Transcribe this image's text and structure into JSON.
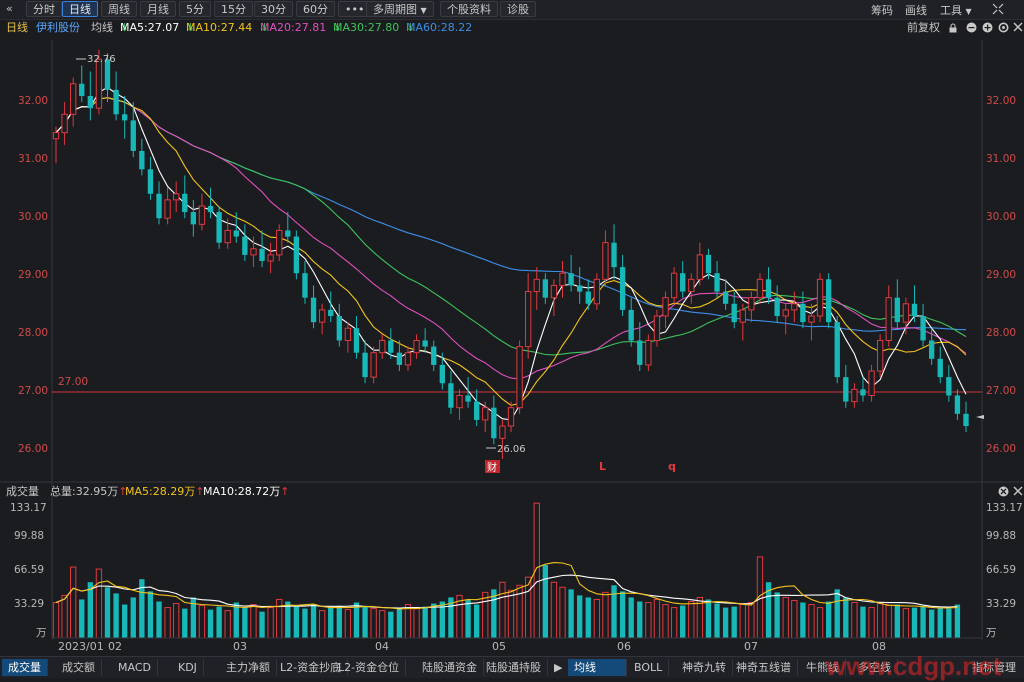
{
  "toolbar": {
    "back": "«",
    "tabs": [
      "分时",
      "日线",
      "周线",
      "月线",
      "5分",
      "15分",
      "30分",
      "60分"
    ],
    "more": "•••",
    "multi_period": "多周期图",
    "multi_arrow": "▼",
    "stock_info": "个股资料",
    "diagnose": "诊股",
    "chips": "筹码",
    "draw": "画线",
    "tools": "工具",
    "tools_arrow": "▼"
  },
  "ma_legend": {
    "period": "日线",
    "stock_name": "伊利股份",
    "avg_line": "均线",
    "ma5": "MA5:27.07",
    "ma10": "MA10:27.44",
    "ma20": "MA20:27.81",
    "ma30": "MA30:27.80",
    "ma60": "MA60:28.22",
    "down_arrow": "↓",
    "adjust": "前复权"
  },
  "price_axis": [
    "32.00",
    "31.00",
    "30.00",
    "29.00",
    "28.00",
    "27.00",
    "26.00"
  ],
  "annotations": {
    "high": "32.76",
    "low": "26.06",
    "ref_line": "27.00",
    "marker_cai": "财",
    "marker_L": "L",
    "marker_q": "q"
  },
  "volume_legend": {
    "title": "成交量",
    "total": "总量:32.95万",
    "ma5": "MA5:28.29万",
    "ma10": "MA10:28.72万",
    "up_arrow": "↑"
  },
  "volume_axis": [
    "133.17",
    "99.88",
    "66.59",
    "33.29",
    "万"
  ],
  "x_axis": [
    "2023/01",
    "02",
    "03",
    "04",
    "05",
    "06",
    "07",
    "08"
  ],
  "bottom_tabs_left": [
    "成交量",
    "成交额",
    "MACD",
    "KDJ",
    "主力净额",
    "L2-资金抄底",
    "L2-资金仓位",
    "陆股通资金",
    "陆股通持股"
  ],
  "bottom_tabs_right": [
    "均线",
    "BOLL",
    "神奇九转",
    "神奇五线谱",
    "牛熊线",
    "多空线",
    "指标管理"
  ],
  "scroll_arrow": "▶",
  "watermark": "www.cdgp.net",
  "colors": {
    "up": "#e0393e",
    "down": "#19b8b8",
    "ma5": "#ffffff",
    "ma10": "#f2c31b",
    "ma20": "#e04fbf",
    "ma30": "#3cc35a",
    "ma60": "#3d8ee8",
    "axis": "#d04a4a",
    "accent": "#3b7fd9"
  },
  "chart_data": {
    "type": "candlestick",
    "ylim": [
      25.75,
      32.85
    ],
    "volume_ylim": [
      0,
      133.17
    ],
    "ohlc": [
      [
        31.3,
        31.5,
        30.9,
        31.4
      ],
      [
        31.4,
        31.9,
        31.2,
        31.7
      ],
      [
        31.7,
        32.3,
        31.5,
        32.2
      ],
      [
        32.2,
        32.5,
        31.9,
        32.0
      ],
      [
        32.0,
        32.4,
        31.6,
        31.8
      ],
      [
        31.8,
        32.76,
        31.7,
        32.6
      ],
      [
        32.6,
        32.7,
        31.9,
        32.1
      ],
      [
        32.1,
        32.4,
        31.6,
        31.7
      ],
      [
        31.7,
        32.0,
        31.3,
        31.6
      ],
      [
        31.6,
        31.9,
        31.0,
        31.1
      ],
      [
        31.1,
        31.3,
        30.7,
        30.8
      ],
      [
        30.8,
        31.0,
        30.3,
        30.4
      ],
      [
        30.4,
        30.6,
        29.9,
        30.0
      ],
      [
        30.0,
        30.5,
        29.9,
        30.3
      ],
      [
        30.3,
        30.6,
        30.1,
        30.4
      ],
      [
        30.4,
        30.7,
        30.0,
        30.1
      ],
      [
        30.1,
        30.3,
        29.7,
        29.9
      ],
      [
        29.9,
        30.4,
        29.8,
        30.2
      ],
      [
        30.2,
        30.5,
        30.0,
        30.1
      ],
      [
        30.1,
        30.2,
        29.5,
        29.6
      ],
      [
        29.6,
        30.0,
        29.5,
        29.8
      ],
      [
        29.8,
        30.1,
        29.6,
        29.7
      ],
      [
        29.7,
        29.9,
        29.3,
        29.4
      ],
      [
        29.4,
        29.7,
        29.2,
        29.5
      ],
      [
        29.5,
        29.8,
        29.2,
        29.3
      ],
      [
        29.3,
        29.6,
        29.1,
        29.4
      ],
      [
        29.4,
        29.9,
        29.3,
        29.8
      ],
      [
        29.8,
        30.1,
        29.6,
        29.7
      ],
      [
        29.7,
        29.8,
        29.0,
        29.1
      ],
      [
        29.1,
        29.3,
        28.6,
        28.7
      ],
      [
        28.7,
        28.9,
        28.2,
        28.3
      ],
      [
        28.3,
        28.6,
        28.1,
        28.5
      ],
      [
        28.5,
        28.8,
        28.3,
        28.4
      ],
      [
        28.4,
        28.6,
        27.9,
        28.0
      ],
      [
        28.0,
        28.3,
        27.8,
        28.2
      ],
      [
        28.2,
        28.4,
        27.7,
        27.8
      ],
      [
        27.8,
        28.0,
        27.3,
        27.4
      ],
      [
        27.4,
        27.9,
        27.3,
        27.8
      ],
      [
        27.8,
        28.1,
        27.7,
        28.0
      ],
      [
        28.0,
        28.2,
        27.7,
        27.8
      ],
      [
        27.8,
        28.0,
        27.5,
        27.6
      ],
      [
        27.6,
        27.9,
        27.5,
        27.8
      ],
      [
        27.8,
        28.1,
        27.7,
        28.0
      ],
      [
        28.0,
        28.2,
        27.8,
        27.9
      ],
      [
        27.9,
        28.0,
        27.5,
        27.6
      ],
      [
        27.6,
        27.8,
        27.2,
        27.3
      ],
      [
        27.3,
        27.5,
        26.8,
        26.9
      ],
      [
        26.9,
        27.2,
        26.7,
        27.1
      ],
      [
        27.1,
        27.4,
        26.9,
        27.0
      ],
      [
        27.0,
        27.2,
        26.6,
        26.7
      ],
      [
        26.7,
        27.0,
        26.5,
        26.9
      ],
      [
        26.9,
        27.1,
        26.3,
        26.4
      ],
      [
        26.4,
        26.7,
        26.06,
        26.6
      ],
      [
        26.6,
        27.0,
        26.5,
        26.9
      ],
      [
        26.9,
        28.0,
        26.8,
        27.9
      ],
      [
        27.9,
        29.1,
        27.7,
        28.8
      ],
      [
        28.8,
        29.2,
        28.5,
        29.0
      ],
      [
        29.0,
        29.1,
        28.6,
        28.7
      ],
      [
        28.7,
        29.0,
        28.4,
        28.9
      ],
      [
        28.9,
        29.3,
        28.7,
        29.1
      ],
      [
        29.1,
        29.4,
        28.8,
        28.9
      ],
      [
        28.9,
        29.2,
        28.6,
        28.8
      ],
      [
        28.8,
        29.0,
        28.5,
        28.6
      ],
      [
        28.6,
        29.1,
        28.5,
        29.0
      ],
      [
        29.0,
        29.8,
        28.9,
        29.6
      ],
      [
        29.6,
        29.9,
        29.0,
        29.2
      ],
      [
        29.2,
        29.4,
        28.4,
        28.5
      ],
      [
        28.5,
        28.7,
        27.9,
        28.0
      ],
      [
        28.0,
        28.3,
        27.5,
        27.6
      ],
      [
        27.6,
        28.1,
        27.5,
        28.0
      ],
      [
        28.0,
        28.5,
        27.9,
        28.4
      ],
      [
        28.4,
        28.8,
        28.2,
        28.7
      ],
      [
        28.7,
        29.2,
        28.6,
        29.1
      ],
      [
        29.1,
        29.3,
        28.7,
        28.8
      ],
      [
        28.8,
        29.1,
        28.6,
        29.0
      ],
      [
        29.0,
        29.6,
        28.9,
        29.4
      ],
      [
        29.4,
        29.5,
        29.0,
        29.1
      ],
      [
        29.1,
        29.3,
        28.7,
        28.8
      ],
      [
        28.8,
        29.0,
        28.5,
        28.6
      ],
      [
        28.6,
        28.8,
        28.2,
        28.3
      ],
      [
        28.3,
        28.6,
        28.0,
        28.5
      ],
      [
        28.5,
        28.8,
        28.3,
        28.7
      ],
      [
        28.7,
        29.1,
        28.6,
        29.0
      ],
      [
        29.0,
        29.2,
        28.6,
        28.7
      ],
      [
        28.7,
        28.9,
        28.3,
        28.4
      ],
      [
        28.4,
        28.6,
        28.1,
        28.5
      ],
      [
        28.5,
        28.8,
        28.3,
        28.6
      ],
      [
        28.6,
        28.8,
        28.2,
        28.3
      ],
      [
        28.3,
        28.6,
        28.0,
        28.4
      ],
      [
        28.4,
        29.1,
        28.3,
        29.0
      ],
      [
        29.0,
        29.1,
        28.2,
        28.3
      ],
      [
        28.3,
        28.4,
        27.3,
        27.4
      ],
      [
        27.4,
        27.6,
        26.9,
        27.0
      ],
      [
        27.0,
        27.3,
        26.9,
        27.2
      ],
      [
        27.2,
        27.4,
        27.0,
        27.1
      ],
      [
        27.1,
        27.6,
        27.0,
        27.5
      ],
      [
        27.5,
        28.1,
        27.4,
        28.0
      ],
      [
        28.0,
        28.9,
        27.9,
        28.7
      ],
      [
        28.7,
        29.0,
        28.2,
        28.3
      ],
      [
        28.3,
        28.7,
        28.1,
        28.6
      ],
      [
        28.6,
        28.9,
        28.3,
        28.4
      ],
      [
        28.4,
        28.6,
        27.9,
        28.0
      ],
      [
        28.0,
        28.2,
        27.6,
        27.7
      ],
      [
        27.7,
        27.9,
        27.3,
        27.4
      ],
      [
        27.4,
        27.6,
        27.0,
        27.1
      ],
      [
        27.1,
        27.2,
        26.7,
        26.8
      ],
      [
        26.8,
        27.0,
        26.5,
        26.6
      ]
    ],
    "volume": [
      35,
      42,
      70,
      38,
      55,
      68,
      50,
      44,
      33,
      40,
      58,
      46,
      36,
      30,
      34,
      29,
      40,
      32,
      28,
      31,
      27,
      35,
      30,
      33,
      26,
      30,
      38,
      36,
      31,
      29,
      33,
      27,
      30,
      32,
      28,
      35,
      31,
      29,
      27,
      26,
      30,
      33,
      29,
      31,
      34,
      36,
      40,
      42,
      38,
      33,
      45,
      48,
      55,
      47,
      52,
      60,
      133,
      72,
      55,
      50,
      48,
      42,
      40,
      38,
      45,
      52,
      46,
      40,
      36,
      35,
      38,
      33,
      30,
      32,
      36,
      40,
      38,
      34,
      30,
      31,
      33,
      35,
      80,
      55,
      45,
      40,
      37,
      35,
      33,
      30,
      36,
      48,
      40,
      35,
      31,
      30,
      34,
      32,
      33,
      29,
      30,
      31,
      28,
      30,
      29,
      33
    ]
  }
}
